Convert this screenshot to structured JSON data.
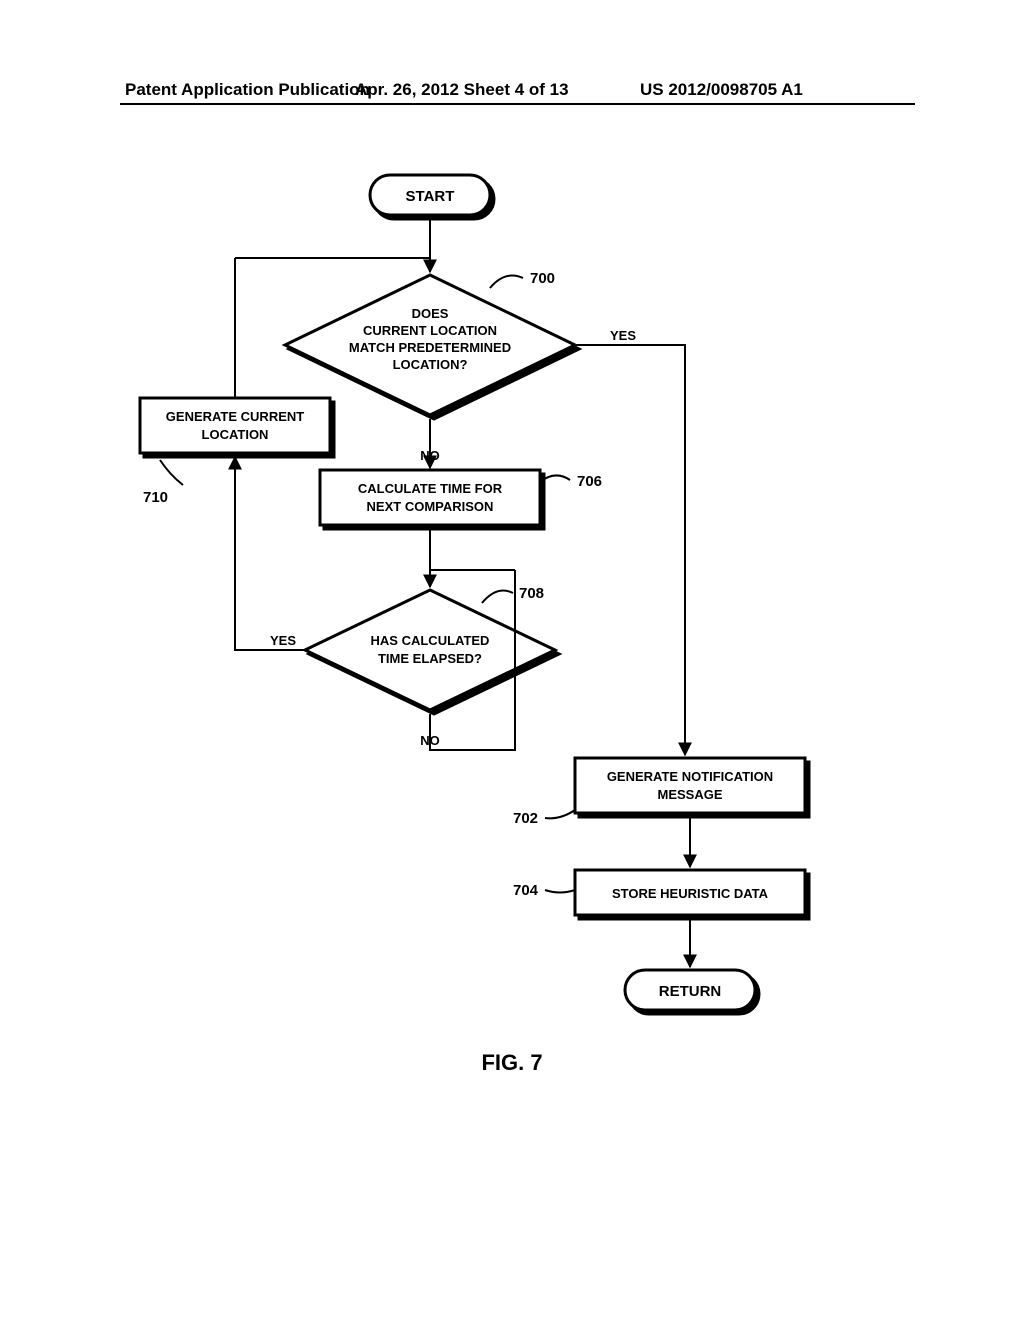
{
  "header": {
    "left": "Patent Application Publication",
    "middle": "Apr. 26, 2012  Sheet 4 of 13",
    "right": "US 2012/0098705 A1"
  },
  "fig_label": "FIG. 7",
  "nodes": {
    "start": "START",
    "decision_700": "DOES\nCURRENT LOCATION\nMATCH PREDETERMINED\nLOCATION?",
    "process_706": "CALCULATE TIME FOR\nNEXT COMPARISON",
    "decision_708": "HAS CALCULATED\nTIME ELAPSED?",
    "process_710": "GENERATE CURRENT\nLOCATION",
    "process_702": "GENERATE NOTIFICATION\nMESSAGE",
    "process_704": "STORE HEURISTIC DATA",
    "return": "RETURN"
  },
  "labels": {
    "ref_700": "700",
    "ref_706": "706",
    "ref_708": "708",
    "ref_710": "710",
    "ref_702": "702",
    "ref_704": "704"
  },
  "edges": {
    "yes": "YES",
    "no": "NO"
  }
}
